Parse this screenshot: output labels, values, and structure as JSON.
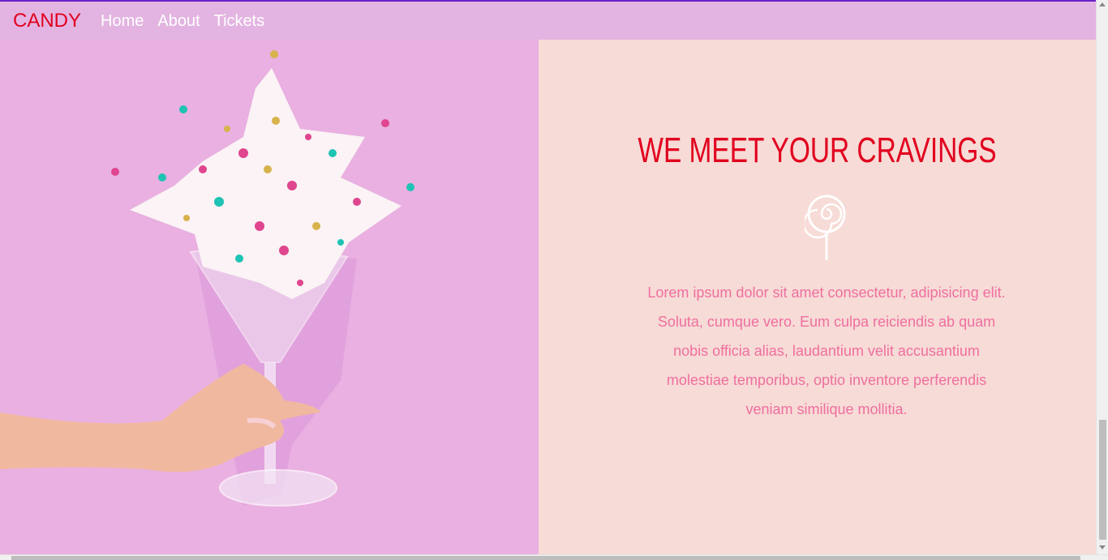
{
  "colors": {
    "brand": "#e1001e",
    "nav_bg": "#e3b4e1",
    "left_panel_bg": "#e9b0e1",
    "right_panel_bg": "#f7dbd6",
    "body_text": "#ef6fa0"
  },
  "nav": {
    "brand": "CANDY",
    "links": [
      "Home",
      "About",
      "Tickets"
    ]
  },
  "hero": {
    "image_alt": "hand holding a martini glass exploding with sprinkles",
    "heading": "WE MEET YOUR CRAVINGS",
    "icon": "lollipop-icon",
    "body": "Lorem ipsum dolor sit amet consectetur, adipisicing elit. Soluta, cumque vero. Eum culpa reiciendis ab quam nobis officia alias, laudantium velit accusantium molestiae temporibus, optio inventore perferendis veniam similique mollitia."
  }
}
